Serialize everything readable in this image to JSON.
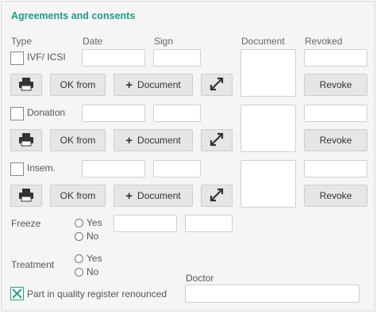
{
  "section_title": "Agreements and consents",
  "headers": {
    "type": "Type",
    "date": "Date",
    "sign": "Sign",
    "document": "Document",
    "revoked": "Revoked"
  },
  "rows": [
    {
      "label": "IVF/ ICSI",
      "ok_from": "OK from",
      "document_btn": "Document",
      "revoke": "Revoke"
    },
    {
      "label": "Donation",
      "ok_from": "OK from",
      "document_btn": "Document",
      "revoke": "Revoke"
    },
    {
      "label": "Insem.",
      "ok_from": "OK from",
      "document_btn": "Document",
      "revoke": "Revoke"
    }
  ],
  "freeze": {
    "label": "Freeze",
    "yes": "Yes",
    "no": "No"
  },
  "treatment": {
    "label": "Treatment",
    "yes": "Yes",
    "no": "No"
  },
  "quality_register": {
    "label": "Part in quality register renounced",
    "checked": true
  },
  "doctor": {
    "label": "Doctor"
  },
  "colors": {
    "accent": "#1e9a8c",
    "button_bg": "#e6e6e6",
    "panel_bg": "#f5f5f5"
  }
}
